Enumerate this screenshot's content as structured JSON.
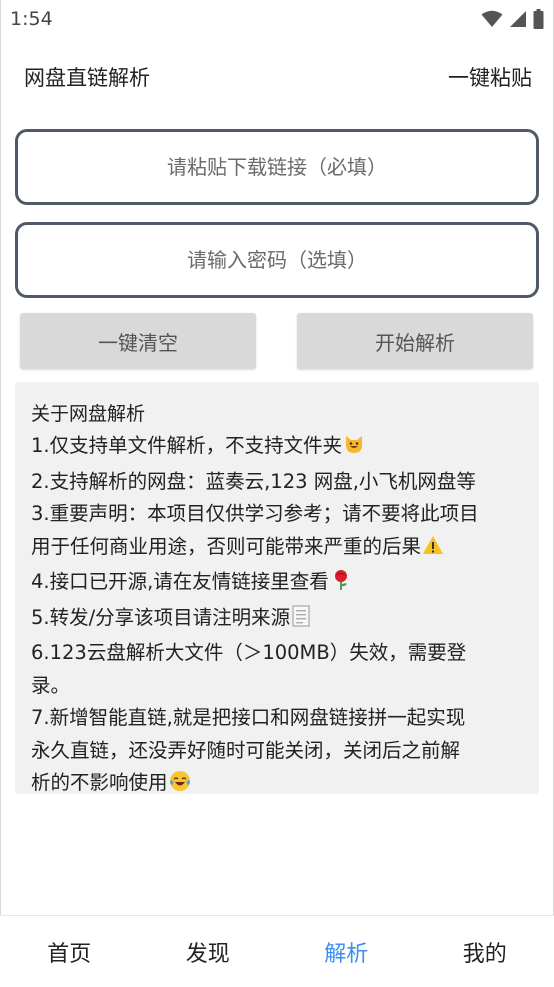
{
  "status_bar": {
    "time": "1:54"
  },
  "app_bar": {
    "title": "网盘直链解析",
    "paste_action": "一键粘贴"
  },
  "form": {
    "link_placeholder": "请粘贴下载链接（必填）",
    "password_placeholder": "请输入密码（选填）"
  },
  "buttons": {
    "clear_label": "一键清空",
    "parse_label": "开始解析"
  },
  "info": {
    "title": "关于网盘解析",
    "lines": [
      "1.仅支持单文件解析，不支持文件夹",
      "2.支持解析的网盘：蓝奏云,123 网盘,小飞机网盘等",
      "3.重要声明：本项目仅供学习参考；请不要将此项目",
      "用于任何商业用途，否则可能带来严重的后果",
      "4.接口已开源,请在友情链接里查看",
      "5.转发/分享该项目请注明来源",
      "6.123云盘解析大文件（＞100MB）失效，需要登",
      "录。",
      "7.新增智能直链,就是把接口和网盘链接拼一起实现",
      "永久直链，还没弄好随时可能关闭，关闭后之前解",
      "析的不影响使用"
    ]
  },
  "bottom_nav": {
    "items": [
      {
        "label": "首页"
      },
      {
        "label": "发现"
      },
      {
        "label": "解析"
      },
      {
        "label": "我的"
      }
    ],
    "active_index": 2,
    "active_color": "#3d8ef2"
  }
}
